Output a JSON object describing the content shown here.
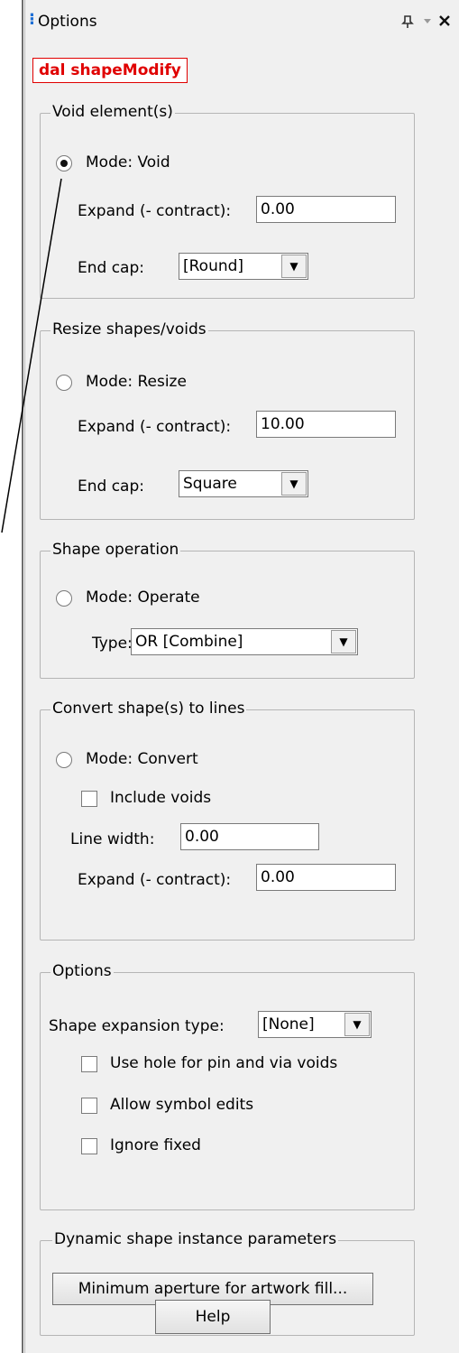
{
  "window": {
    "title": "Options",
    "pin_icon": "pin-icon",
    "dropdown_icon": "chevron-down-icon",
    "close_icon": "close-icon"
  },
  "command_name": "dal shapeModify",
  "void_group": {
    "legend": "Void element(s)",
    "mode_label": "Mode: Void",
    "mode_checked": true,
    "expand_label": "Expand (- contract):",
    "expand_value": "0.00",
    "endcap_label": "End cap:",
    "endcap_value": "[Round]"
  },
  "resize_group": {
    "legend": "Resize shapes/voids",
    "mode_label": "Mode: Resize",
    "expand_label": "Expand (- contract):",
    "expand_value": "10.00",
    "endcap_label": "End cap:",
    "endcap_value": "Square"
  },
  "operation_group": {
    "legend": "Shape operation",
    "mode_label": "Mode: Operate",
    "type_label": "Type:",
    "type_value": "OR [Combine]"
  },
  "convert_group": {
    "legend": "Convert shape(s) to lines",
    "mode_label": "Mode: Convert",
    "include_voids_label": "Include voids",
    "line_width_label": "Line width:",
    "line_width_value": "0.00",
    "expand_label": "Expand (- contract):",
    "expand_value": "0.00"
  },
  "options_group": {
    "legend": "Options",
    "expansion_label": "Shape expansion type:",
    "expansion_value": "[None]",
    "use_hole_label": "Use hole for pin and via voids",
    "allow_symbol_label": "Allow symbol edits",
    "ignore_fixed_label": "Ignore fixed"
  },
  "dynamic_group": {
    "legend": "Dynamic shape instance parameters",
    "button_label": "Minimum aperture for artwork fill..."
  },
  "help_button": "Help"
}
